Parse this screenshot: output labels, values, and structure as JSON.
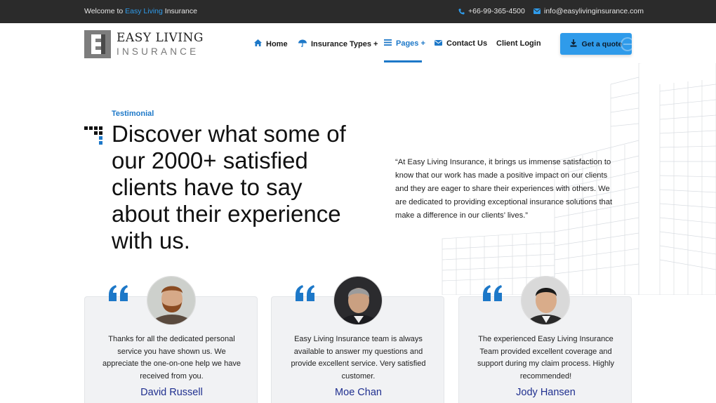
{
  "topbar": {
    "welcome_prefix": "Welcome to",
    "welcome_brand": "Easy Living",
    "welcome_suffix": "Insurance",
    "phone": "+66-99-365-4500",
    "email": "info@easylivinginsurance.com"
  },
  "logo": {
    "line1": "EASY LIVING",
    "line2": "INSURANCE"
  },
  "nav": {
    "items": [
      {
        "label": "Home",
        "icon": "home-icon"
      },
      {
        "label": "Insurance Types +",
        "icon": "umbrella-icon"
      },
      {
        "label": "Pages +",
        "icon": "menu-lines-icon",
        "active": true
      },
      {
        "label": "Contact Us",
        "icon": "envelope-icon"
      },
      {
        "label": "Client Login"
      }
    ],
    "cta": "Get a quote"
  },
  "hero": {
    "eyebrow": "Testimonial",
    "headline": "Discover what some of our 2000+ satisfied clients have to say about their experience with us.",
    "quote": "“At Easy Living Insurance, it brings us immense satisfaction to know that our work has made a positive impact on our clients and they are eager to share their experiences with others. We are dedicated to providing exceptional insurance solutions that make a difference in our clients’ lives.”"
  },
  "testimonials": [
    {
      "text": "Thanks for all the dedicated personal service you have shown us. We appreciate the one-on-one help we have received from you.",
      "name": "David Russell"
    },
    {
      "text": "Easy Living Insurance team is always available to answer my questions and provide excellent service. Very satisfied customer.",
      "name": "Moe Chan"
    },
    {
      "text": "The experienced Easy Living Insurance Team provided excellent coverage and support during my claim process. Highly recommended!",
      "name": "Jody Hansen"
    }
  ],
  "colors": {
    "accent": "#1d78c8",
    "button": "#2f9bea",
    "topbar": "#2b2b2b",
    "name": "#1f2f8f"
  }
}
